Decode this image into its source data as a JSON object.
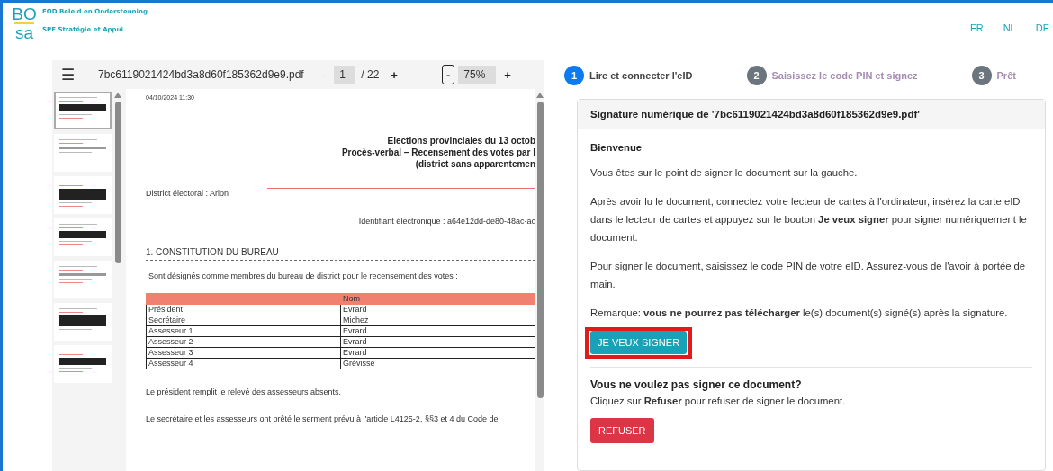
{
  "header": {
    "org_lines": [
      "FOD Beleid en Ondersteuning",
      "SPF Stratégie et Appui"
    ],
    "logo_text": [
      "BO",
      "sa"
    ],
    "languages": [
      {
        "label": "FR",
        "selected": false
      },
      {
        "label": "NL",
        "selected": false
      },
      {
        "label": "DE",
        "selected": false
      }
    ]
  },
  "viewer": {
    "menu_glyph": "☰",
    "filename": "7bc6119021424bd3a8d60f185362d9e9.pdf",
    "page_prev": {
      "label": "-",
      "disabled": true
    },
    "page": "1",
    "page_total": "/ 22",
    "page_next": {
      "label": "+",
      "disabled": false
    },
    "zoom_out": {
      "label": "-",
      "focused": true
    },
    "zoom": "75%",
    "zoom_in": {
      "label": "+",
      "focused": false
    },
    "thumbnails": [
      {
        "selected": true
      },
      {
        "selected": false
      },
      {
        "selected": false
      },
      {
        "selected": false
      },
      {
        "selected": false
      },
      {
        "selected": false
      },
      {
        "selected": false
      }
    ],
    "document": {
      "timestamp": "04/10/2024 11:30",
      "title_lines": [
        "Elections provinciales du 13 octob",
        "Procès-verbal – Recensement des votes par l",
        "(district sans apparentemen"
      ],
      "district": "District électoral : Arlon",
      "identifier": "Identifiant électronique : a64e12dd-de80-48ac-ac",
      "section": "1. CONSTITUTION DU BUREAU",
      "intro": "Sont désignés comme membres du bureau de district pour le recensement des votes :",
      "table": {
        "columns": [
          "",
          "Nom"
        ],
        "rows": [
          [
            "Président",
            "Evrard"
          ],
          [
            "Secrétaire",
            "Michez"
          ],
          [
            "Assesseur 1",
            "Evrard"
          ],
          [
            "Assesseur 2",
            "Evrard"
          ],
          [
            "Assesseur 3",
            "Evrard"
          ],
          [
            "Assesseur 4",
            "Grévisse"
          ]
        ]
      },
      "paragraphs": [
        "Le président remplit le relevé des assesseurs absents.",
        "Le secrétaire et les assesseurs ont prêté le serment prévu à l'article L4125-2, §§3 et 4 du Code de"
      ]
    }
  },
  "steps": [
    {
      "number": "1",
      "label": "Lire et connecter l'eID",
      "active": true
    },
    {
      "number": "2",
      "label": "Saisissez le code PIN et signez",
      "active": false
    },
    {
      "number": "3",
      "label": "Prêt",
      "active": false
    }
  ],
  "card": {
    "title": "Signature numérique de '7bc6119021424bd3a8d60f185362d9e9.pdf'",
    "heading": "Bienvenue",
    "paragraphs": [
      "Vous êtes sur le point de signer le document sur la gauche.",
      "Après avoir lu le document, connectez votre lecteur de cartes à l'ordinateur, insérez la carte eID dans le lecteur de cartes et appuyez sur le bouton **Je veux signer** pour signer numériquement le document.",
      "Pour signer le document, saisissez le code PIN de votre eID. Assurez-vous de l'avoir à portée de main.",
      "Remarque: **vous ne pourrez pas télécharger** le(s) document(s) signé(s) après la signature."
    ],
    "sign_button": {
      "label": "JE VEUX SIGNER",
      "highlighted": true
    },
    "refuse_heading": "Vous ne voulez pas signer ce document?",
    "refuse_text": "Cliquez sur **Refuser** pour refuser de signer le document.",
    "refuse_button": {
      "label": "REFUSER"
    }
  }
}
